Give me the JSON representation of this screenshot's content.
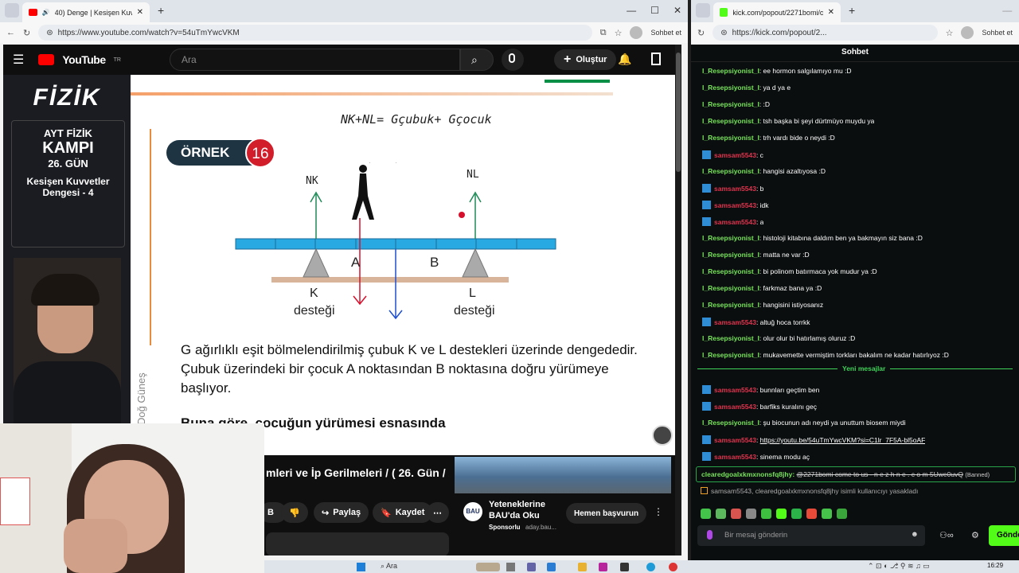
{
  "left_browser": {
    "tab_title": "40) Denge | Kesişen Kuvvetler",
    "url": "https://www.youtube.com/watch?v=54uTmYwcVKM",
    "sohbet": "Sohbet et"
  },
  "youtube": {
    "logo": "YouTube",
    "logo_country": "TR",
    "search_placeholder": "Ara",
    "create_label": "Oluştur",
    "video": {
      "brand": "FİZİK",
      "camp_line1": "AYT FİZİK",
      "camp_line2": "KAMPI",
      "camp_line3": "26. GÜN",
      "camp_line4": "Kesişen Kuvvetler",
      "camp_line5": "Dengesi - 4",
      "handwritten_eq": "NK+NL= Gçubuk+ Gçocuk",
      "ornek_label": "ÖRNEK",
      "ornek_num": "16",
      "label_nk": "NK",
      "label_nl": "NL",
      "label_a": "A",
      "label_b": "B",
      "label_k": "K",
      "label_l": "L",
      "destegi": "desteği",
      "question_text": "G ağırlıklı eşit bölmelendirilmiş çubuk K ve L destekleri üzerinde dengededir. Çubuk üzerindeki bir çocuk A noktasından B noktasına doğru yürümeye başlıyor.",
      "question_bold": "Buna göre, çocuğun yürümesi esnasında",
      "side_text": "Doğ Güneş"
    },
    "title": "mleri ve İp Gerilmeleri / ( 26. Gün / 2.",
    "like_short": "B",
    "share": "Paylaş",
    "save": "Kaydet",
    "ad": {
      "title_line1": "Yeteneklerine",
      "title_line2": "BAU'da Oku",
      "sponsor": "Sponsorlu",
      "sponsor_url": "aday.bau...",
      "cta": "Hemen başvurun",
      "logo": "BAU"
    }
  },
  "right_browser": {
    "url": "https://kick.com/popout/2...",
    "tab_title": "kick.com/popout/2271bomi/chat",
    "sohbet": "Sohbet et"
  },
  "chat": {
    "header": "Sohbet",
    "messages": [
      {
        "user": "I_Resepsiyonist_I",
        "text": "ee hormon salgılamıyo mu :D",
        "type": 1
      },
      {
        "user": "I_Resepsiyonist_I",
        "text": "ya d ya e",
        "type": 1
      },
      {
        "user": "I_Resepsiyonist_I",
        "text": ":D",
        "type": 1
      },
      {
        "user": "I_Resepsiyonist_I",
        "text": "tsh başka bi şeyi dürtmüyo muydu ya",
        "type": 1
      },
      {
        "user": "I_Resepsiyonist_I",
        "text": "trh vardı bide o neydi :D",
        "type": 1
      },
      {
        "user": "samsam5543",
        "text": "c",
        "type": 2
      },
      {
        "user": "I_Resepsiyonist_I",
        "text": "hangisi azaltıyosa :D",
        "type": 1
      },
      {
        "user": "samsam5543",
        "text": "b",
        "type": 2
      },
      {
        "user": "samsam5543",
        "text": "idk",
        "type": 2
      },
      {
        "user": "samsam5543",
        "text": "a",
        "type": 2
      },
      {
        "user": "I_Resepsiyonist_I",
        "text": "histoloji kitabına daldım ben ya bakmayın siz bana :D",
        "type": 1
      },
      {
        "user": "I_Resepsiyonist_I",
        "text": "matta ne var :D",
        "type": 1
      },
      {
        "user": "I_Resepsiyonist_I",
        "text": "bi polinom batırmaca yok mudur ya :D",
        "type": 1
      },
      {
        "user": "I_Resepsiyonist_I",
        "text": "farkmaz bana ya :D",
        "type": 1
      },
      {
        "user": "I_Resepsiyonist_I",
        "text": "hangisini istiyosanız",
        "type": 1
      },
      {
        "user": "samsam5543",
        "text": "altuğ hoca torrkk",
        "type": 2
      },
      {
        "user": "I_Resepsiyonist_I",
        "text": "olur olur bi hatırlamış oluruz :D",
        "type": 1
      },
      {
        "user": "I_Resepsiyonist_I",
        "text": "mukavemette vermiştim torkları bakalım ne kadar hatırlıyoz :D",
        "type": 1
      }
    ],
    "new_messages_label": "Yeni mesajlar",
    "messages_new": [
      {
        "user": "samsam5543",
        "text": "bunnları geçtim ben",
        "type": 2
      },
      {
        "user": "samsam5543",
        "text": "barfiks kuralını geç",
        "type": 2
      },
      {
        "user": "I_Resepsiyonist_I",
        "text": "şu biocunun adı neydi ya unuttum biosem miydi",
        "type": 1
      },
      {
        "user": "samsam5543",
        "text": "https://youtu.be/54uTmYwcVKM?si=C1lr_7F5A-bl5oAF",
        "type": 2
      },
      {
        "user": "samsam5543",
        "text": "sinema modu aç",
        "type": 2
      }
    ],
    "banned_user": "clearedgoalxkmxnonsfq8jhy",
    "banned_text": "@2271bomi come to us - n e z h n e . c o m 5Uwe0uvQ",
    "banned_tag": "(Banned)",
    "ban_notice": "samsam5543, clearedgoalxkmxnonsfq8jhy isimli kullanıcıyı yasakladı",
    "input_placeholder": "Bir mesaj gönderin",
    "send_label": "Gönder"
  },
  "taskbar": {
    "search": "Ara",
    "time": "16:29"
  },
  "colors": {
    "user1": "#76e25a",
    "user2": "#e0344e",
    "kick_green": "#53fc18",
    "yt_red": "#ff0000"
  }
}
